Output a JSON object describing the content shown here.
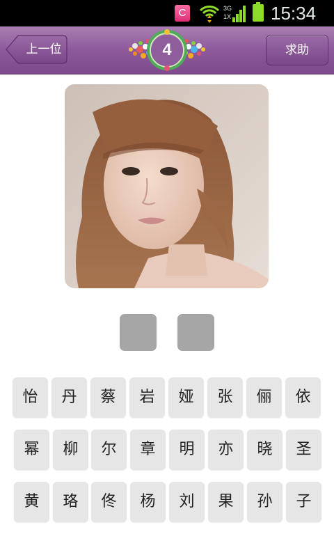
{
  "status_bar": {
    "app_icon_letter": "C",
    "network_label_top": "3G",
    "network_label_bottom": "1X",
    "time": "15:34"
  },
  "header": {
    "back_label": "上一位",
    "level": "4",
    "help_label": "求助"
  },
  "puzzle": {
    "answer_slots": [
      "",
      ""
    ],
    "letter_rows": [
      [
        "怡",
        "丹",
        "蔡",
        "岩",
        "娅",
        "张",
        "俪",
        "依"
      ],
      [
        "幂",
        "柳",
        "尔",
        "章",
        "明",
        "亦",
        "晓",
        "圣"
      ],
      [
        "黄",
        "珞",
        "佟",
        "杨",
        "刘",
        "果",
        "孙",
        "子"
      ]
    ]
  }
}
